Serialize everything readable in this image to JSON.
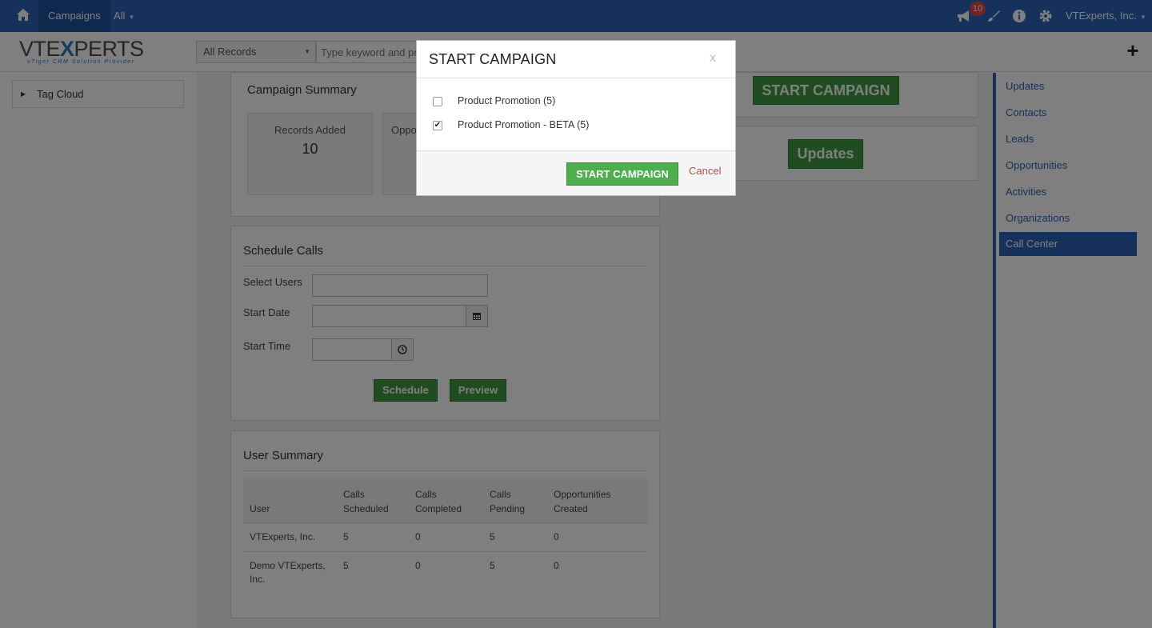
{
  "topbar": {
    "campaigns": "Campaigns",
    "all": "All",
    "notification_count": "10",
    "user_name": "VTExperts, Inc."
  },
  "logo": {
    "brand_a": "VTE",
    "brand_x": "X",
    "brand_b": "PERTS",
    "tagline": "vTiger CRM Solution Provider"
  },
  "search": {
    "records_select": "All Records",
    "placeholder": "Type keyword and press enter"
  },
  "leftcol": {
    "tag_cloud": "Tag Cloud"
  },
  "campaign_summary": {
    "title": "Campaign Summary",
    "records_added_label": "Records Added",
    "records_added_value": "10",
    "opportunities_label": "Oppo"
  },
  "schedule_calls": {
    "title": "Schedule Calls",
    "select_users_label": "Select Users",
    "start_date_label": "Start Date",
    "start_time_label": "Start Time",
    "schedule_button": "Schedule",
    "preview_button": "Preview"
  },
  "user_summary": {
    "title": "User Summary",
    "columns": [
      "User",
      "Calls Scheduled",
      "Calls Completed",
      "Calls Pending",
      "Opportunities Created"
    ],
    "rows": [
      [
        "VTExperts, Inc.",
        "5",
        "0",
        "5",
        "0"
      ],
      [
        "Demo VTExperts, Inc.",
        "5",
        "0",
        "5",
        "0"
      ]
    ]
  },
  "right_panel": {
    "start_campaign_button": "START CAMPAIGN",
    "updates_button": "Updates"
  },
  "rightnav": {
    "items": [
      "Updates",
      "Contacts",
      "Leads",
      "Opportunities",
      "Activities",
      "Organizations",
      "Call Center"
    ],
    "active": "Call Center"
  },
  "modal": {
    "title": "START CAMPAIGN",
    "close": "x",
    "options": [
      {
        "label": "Product Promotion (5)",
        "checked": false
      },
      {
        "label": "Product Promotion - BETA (5)",
        "checked": true
      }
    ],
    "start_button": "START CAMPAIGN",
    "cancel": "Cancel"
  },
  "colors": {
    "brand_blue": "#2c63b8",
    "green_button": "#4cae4c",
    "cancel_red": "#b94a48",
    "badge_red": "#e04a3a"
  }
}
